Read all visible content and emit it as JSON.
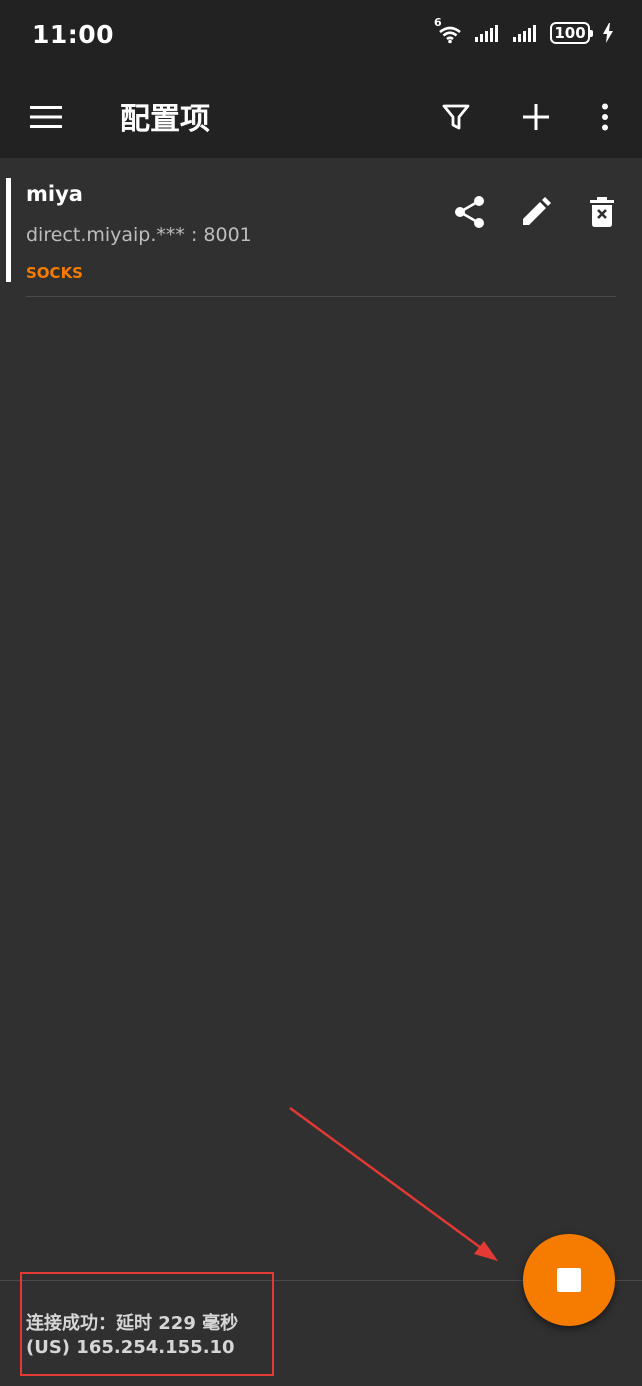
{
  "status_bar": {
    "time": "11:00",
    "wifi_label": "6",
    "battery": "100"
  },
  "app_bar": {
    "title": "配置项",
    "icons": [
      "menu-icon",
      "filter-icon",
      "add-icon",
      "more-vert-icon"
    ]
  },
  "servers": [
    {
      "name": "miya",
      "address": "direct.miyaip.*** : 8001",
      "type": "SOCKS",
      "actions": [
        "share-icon",
        "edit-icon",
        "delete-icon"
      ]
    }
  ],
  "connection": {
    "line1": "连接成功：延时 229 毫秒",
    "line2": "(US) 165.254.155.10"
  },
  "fab": {
    "icon": "stop-icon"
  },
  "colors": {
    "background": "#303030",
    "app_bar": "#222222",
    "accent": "#f57c00",
    "annotation": "#e53935"
  }
}
